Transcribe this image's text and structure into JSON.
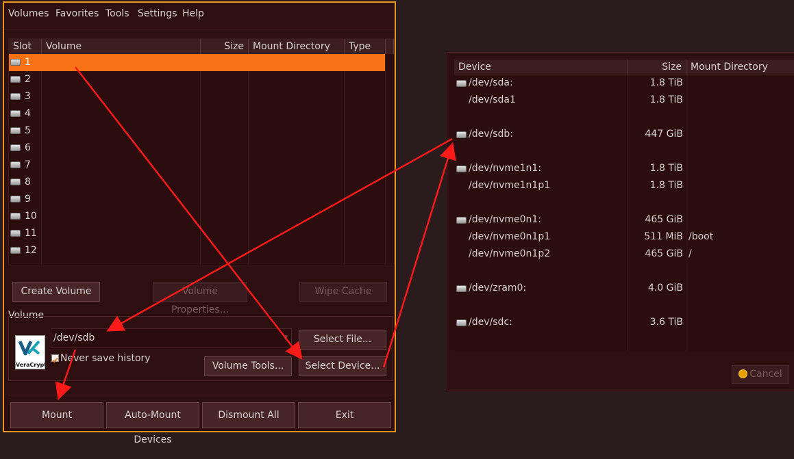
{
  "menu": [
    "Volumes",
    "Favorites",
    "Tools",
    "Settings",
    "Help"
  ],
  "volume_table": {
    "headers": {
      "slot": "Slot",
      "volume": "Volume",
      "size": "Size",
      "mount_dir": "Mount Directory",
      "type": "Type"
    },
    "slots": [
      "1",
      "2",
      "3",
      "4",
      "5",
      "6",
      "7",
      "8",
      "9",
      "10",
      "11",
      "12"
    ],
    "selected_slot": "1"
  },
  "buttons": {
    "create_volume": "Create Volume",
    "volume_properties": "Volume Properties...",
    "wipe_cache": "Wipe Cache",
    "select_file": "Select File...",
    "volume_tools": "Volume Tools...",
    "select_device": "Select Device...",
    "mount": "Mount",
    "auto_mount": "Auto-Mount Devices",
    "dismount_all": "Dismount All",
    "exit": "Exit"
  },
  "volume_group": {
    "label": "Volume",
    "path": "/dev/sdb",
    "never_save_history": "Never save history",
    "never_save_checked": true,
    "logo_text": "VeraCrypt"
  },
  "device_dialog": {
    "headers": {
      "device": "Device",
      "size": "Size",
      "mount_dir": "Mount Directory"
    },
    "rows": [
      {
        "device": "/dev/sda:",
        "size": "1.8 TiB",
        "mount": "",
        "icon": true
      },
      {
        "device": "/dev/sda1",
        "size": "1.8 TiB",
        "mount": "",
        "icon": false
      },
      {
        "device": "",
        "size": "",
        "mount": "",
        "icon": false
      },
      {
        "device": "/dev/sdb:",
        "size": "447 GiB",
        "mount": "",
        "icon": true
      },
      {
        "device": "",
        "size": "",
        "mount": "",
        "icon": false
      },
      {
        "device": "/dev/nvme1n1:",
        "size": "1.8 TiB",
        "mount": "",
        "icon": true
      },
      {
        "device": "/dev/nvme1n1p1",
        "size": "1.8 TiB",
        "mount": "",
        "icon": false
      },
      {
        "device": "",
        "size": "",
        "mount": "",
        "icon": false
      },
      {
        "device": "/dev/nvme0n1:",
        "size": "465 GiB",
        "mount": "",
        "icon": true
      },
      {
        "device": "/dev/nvme0n1p1",
        "size": "511 MiB",
        "mount": "/boot",
        "icon": false
      },
      {
        "device": "/dev/nvme0n1p2",
        "size": "465 GiB",
        "mount": "/",
        "icon": false
      },
      {
        "device": "",
        "size": "",
        "mount": "",
        "icon": false
      },
      {
        "device": "/dev/zram0:",
        "size": "4.0 GiB",
        "mount": "",
        "icon": true
      },
      {
        "device": "",
        "size": "",
        "mount": "",
        "icon": false
      },
      {
        "device": "/dev/sdc:",
        "size": "3.6 TiB",
        "mount": "",
        "icon": true
      }
    ],
    "cancel": "Cancel"
  },
  "colors": {
    "accent": "#f97316",
    "window_border": "#e79521",
    "arrow": "#ff1a1a",
    "background": "#2e0f0f"
  },
  "icons": {
    "drive": "drive-icon",
    "cancel": "cancel-icon",
    "logo": "veracrypt-logo"
  }
}
